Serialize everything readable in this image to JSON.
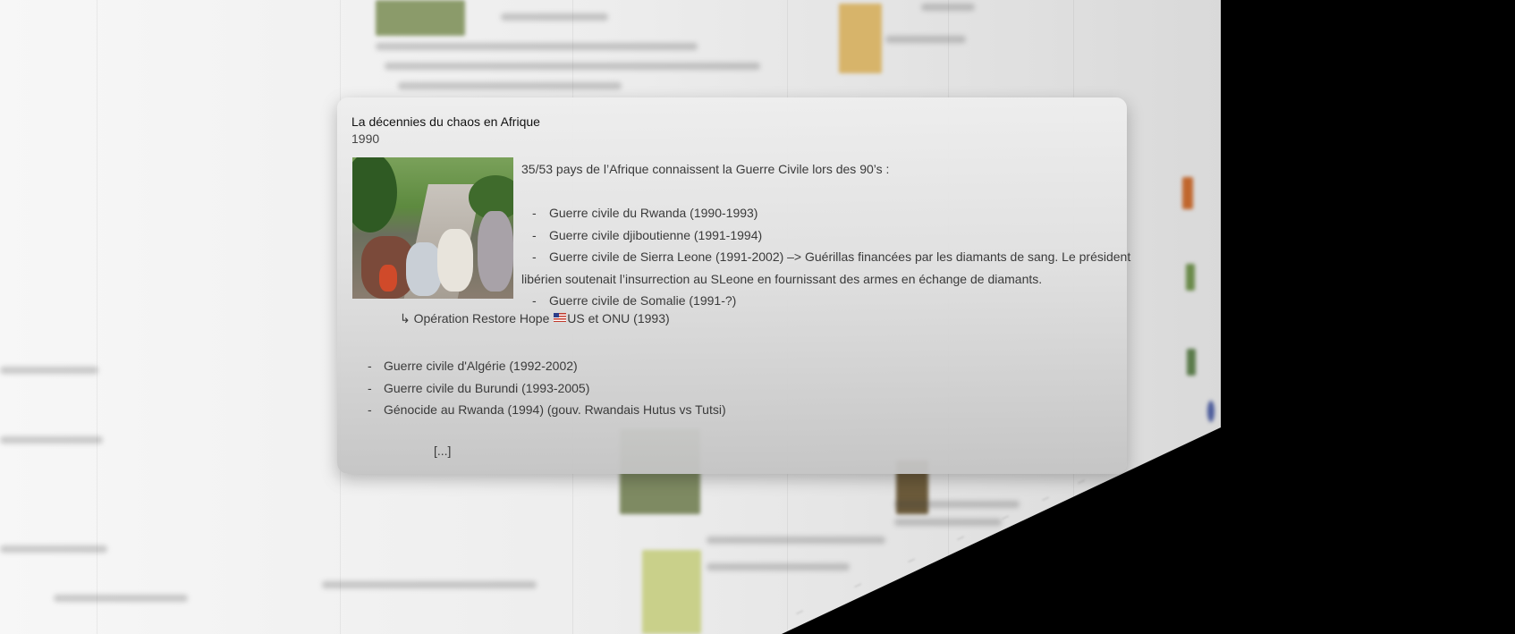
{
  "card": {
    "title": "La décennies du chaos en Afrique",
    "year": "1990",
    "image_alt": "refugees-column-photo",
    "intro": "35/53 pays de l’Afrique connaissent la Guerre Civile lors des 90’s :",
    "bullets": [
      "Guerre civile du Rwanda (1990-1993)",
      "Guerre civile djiboutienne (1991-1994)",
      "Guerre civile de Sierra Leone (1991-2002) –> Guérillas financées par les diamants de sang. Le président"
    ],
    "continuation": "libérien soutenait l’insurrection au SLeone en fournissant des armes en échange de diamants.",
    "bullet_somalia": "Guerre civile de Somalie (1991-?)",
    "sub_arrow": "↳",
    "sub_prefix": "Opération Restore Hope",
    "sub_suffix": "US et ONU (1993)",
    "lower_bullets": [
      "Guerre civile d'Algérie (1992-2002)",
      "Guerre civile du Burundi (1993-2005)",
      "Génocide au Rwanda (1994) (gouv. Rwandais Hutus vs Tutsi)"
    ],
    "ellipsis": "[...]",
    "dash": "-"
  }
}
